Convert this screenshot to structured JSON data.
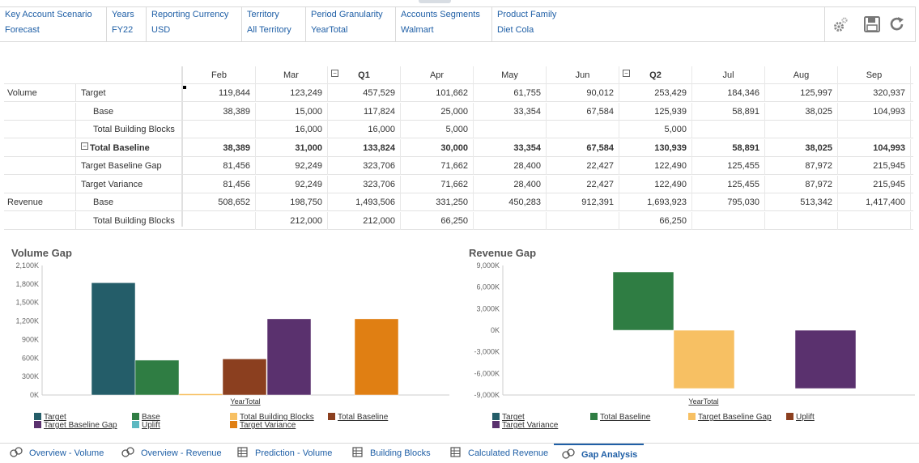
{
  "pov": [
    {
      "label": "Key Account Scenario",
      "value": "Forecast"
    },
    {
      "label": "Years",
      "value": "FY22"
    },
    {
      "label": "Reporting Currency",
      "value": "USD"
    },
    {
      "label": "Territory",
      "value": "All Territory"
    },
    {
      "label": "Period Granularity",
      "value": "YearTotal"
    },
    {
      "label": "Accounts Segments",
      "value": "Walmart"
    },
    {
      "label": "Product Family",
      "value": "Diet Cola"
    }
  ],
  "toolbar": {
    "settings_icon": "gear-icon",
    "save_icon": "save-icon",
    "refresh_icon": "refresh-icon"
  },
  "grid": {
    "columns": [
      "Feb",
      "Mar",
      "Q1",
      "Apr",
      "May",
      "Jun",
      "Q2",
      "Jul",
      "Aug",
      "Sep"
    ],
    "rows": [
      {
        "group": "Volume",
        "label": "Target",
        "indent": false,
        "bold": false,
        "values": [
          "119,844",
          "123,249",
          "457,529",
          "101,662",
          "61,755",
          "90,012",
          "253,429",
          "184,346",
          "125,997",
          "320,937"
        ]
      },
      {
        "group": "",
        "label": "Base",
        "indent": true,
        "bold": false,
        "values": [
          "38,389",
          "15,000",
          "117,824",
          "25,000",
          "33,354",
          "67,584",
          "125,939",
          "58,891",
          "38,025",
          "104,993"
        ]
      },
      {
        "group": "",
        "label": "Total Building Blocks",
        "indent": true,
        "bold": false,
        "values": [
          "",
          "16,000",
          "16,000",
          "5,000",
          "",
          "",
          "5,000",
          "",
          "",
          ""
        ]
      },
      {
        "group": "",
        "label": "Total Baseline",
        "indent": false,
        "bold": true,
        "collapse": true,
        "values": [
          "38,389",
          "31,000",
          "133,824",
          "30,000",
          "33,354",
          "67,584",
          "130,939",
          "58,891",
          "38,025",
          "104,993"
        ]
      },
      {
        "group": "",
        "label": "Target Baseline Gap",
        "indent": false,
        "bold": false,
        "values": [
          "81,456",
          "92,249",
          "323,706",
          "71,662",
          "28,400",
          "22,427",
          "122,490",
          "125,455",
          "87,972",
          "215,945"
        ]
      },
      {
        "group": "",
        "label": "Target Variance",
        "indent": false,
        "bold": false,
        "values": [
          "81,456",
          "92,249",
          "323,706",
          "71,662",
          "28,400",
          "22,427",
          "122,490",
          "125,455",
          "87,972",
          "215,945"
        ]
      },
      {
        "group": "Revenue",
        "label": "Base",
        "indent": true,
        "bold": false,
        "values": [
          "508,652",
          "198,750",
          "1,493,506",
          "331,250",
          "450,283",
          "912,391",
          "1,693,923",
          "795,030",
          "513,342",
          "1,417,400"
        ]
      },
      {
        "group": "",
        "label": "Total Building Blocks",
        "indent": true,
        "bold": false,
        "values": [
          "",
          "212,000",
          "212,000",
          "66,250",
          "",
          "",
          "66,250",
          "",
          "",
          ""
        ]
      }
    ]
  },
  "chart_data": [
    {
      "type": "bar",
      "title": "Volume Gap",
      "categories": [
        "YearTotal"
      ],
      "ylim": [
        0,
        2100
      ],
      "yticks": [
        "0K",
        "300K",
        "600K",
        "900K",
        "1,200K",
        "1,500K",
        "1,800K",
        "2,100K"
      ],
      "ytick_values": [
        0,
        300,
        600,
        900,
        1200,
        1500,
        1800,
        2100
      ],
      "series": [
        {
          "name": "Target",
          "values": [
            1820
          ],
          "color": "#245d69"
        },
        {
          "name": "Base",
          "values": [
            565
          ],
          "color": "#2f7d43"
        },
        {
          "name": "Total Building Blocks",
          "values": [
            20
          ],
          "color": "#f7c063"
        },
        {
          "name": "Total Baseline",
          "values": [
            585
          ],
          "color": "#8b3f1f"
        },
        {
          "name": "Target Baseline Gap",
          "values": [
            1235
          ],
          "color": "#5a316e"
        },
        {
          "name": "Uplift",
          "values": [
            0
          ],
          "color": "#5cb8c1"
        },
        {
          "name": "Target Variance",
          "values": [
            1235
          ],
          "color": "#e07f13"
        }
      ],
      "xlabel": "YearTotal"
    },
    {
      "type": "bar",
      "title": "Revenue Gap",
      "categories": [
        "YearTotal"
      ],
      "ylim": [
        -9000,
        9000
      ],
      "yticks": [
        "-9,000K",
        "-6,000K",
        "-3,000K",
        "0K",
        "3,000K",
        "6,000K",
        "9,000K"
      ],
      "ytick_values": [
        -9000,
        -6000,
        -3000,
        0,
        3000,
        6000,
        9000
      ],
      "series": [
        {
          "name": "Target",
          "values": [
            0
          ],
          "color": "#245d69"
        },
        {
          "name": "Total Baseline",
          "values": [
            8100
          ],
          "color": "#2f7d43"
        },
        {
          "name": "Target Baseline Gap",
          "values": [
            -8100
          ],
          "color": "#f7c063"
        },
        {
          "name": "Uplift",
          "values": [
            0
          ],
          "color": "#8b3f1f"
        },
        {
          "name": "Target Variance",
          "values": [
            -8100
          ],
          "color": "#5a316e"
        }
      ],
      "xlabel": "YearTotal"
    }
  ],
  "volume_legend": [
    {
      "name": "Target",
      "color": "#245d69"
    },
    {
      "name": "Target Baseline Gap",
      "color": "#5a316e"
    },
    {
      "name": "Base",
      "color": "#2f7d43"
    },
    {
      "name": "Uplift",
      "color": "#5cb8c1"
    },
    {
      "name": "Total Building Blocks",
      "color": "#f7c063"
    },
    {
      "name": "Target Variance",
      "color": "#e07f13"
    },
    {
      "name": "Total Baseline",
      "color": "#8b3f1f"
    }
  ],
  "revenue_legend": [
    {
      "name": "Target",
      "color": "#245d69"
    },
    {
      "name": "Target Variance",
      "color": "#5a316e"
    },
    {
      "name": "Total Baseline",
      "color": "#2f7d43"
    },
    {
      "name": "Target Baseline Gap",
      "color": "#f7c063"
    },
    {
      "name": "Uplift",
      "color": "#8b3f1f"
    }
  ],
  "tabs": [
    {
      "label": "Overview - Volume",
      "icon": "chart-icon",
      "active": false
    },
    {
      "label": "Overview - Revenue",
      "icon": "chart-icon",
      "active": false
    },
    {
      "label": "Prediction - Volume",
      "icon": "form-icon",
      "active": false
    },
    {
      "label": "Building Blocks",
      "icon": "form-icon",
      "active": false
    },
    {
      "label": "Calculated Revenue",
      "icon": "form-icon",
      "active": false
    },
    {
      "label": "Gap Analysis",
      "icon": "chart-icon",
      "active": true
    }
  ]
}
